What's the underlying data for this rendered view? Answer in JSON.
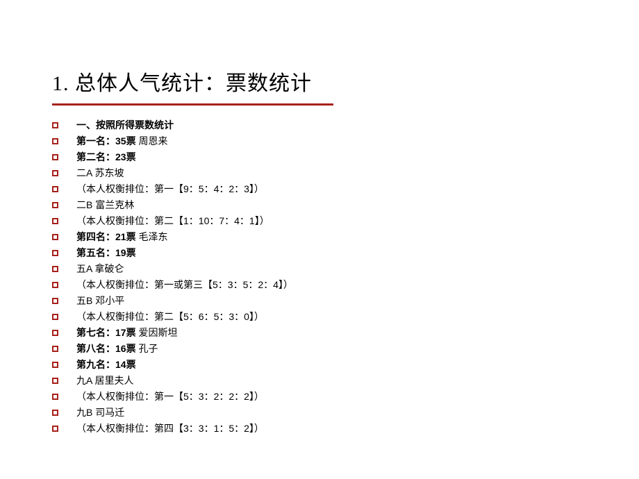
{
  "title": "1.  总体人气统计：票数统计",
  "items": [
    {
      "bold": "一、按照所得票数统计",
      "normal": ""
    },
    {
      "bold": "第一名：35票 ",
      "normal": "周恩来"
    },
    {
      "bold": "第二名：23票",
      "normal": ""
    },
    {
      "bold": "",
      "normal": "二A  苏东坡"
    },
    {
      "bold": "",
      "normal": "（本人权衡排位：第一【9：5：4：2：3】）"
    },
    {
      "bold": "",
      "normal": "二B  富兰克林"
    },
    {
      "bold": "",
      "normal": "（本人权衡排位：第二【1：10：7：4：1】）"
    },
    {
      "bold": "第四名：21票 ",
      "normal": "毛泽东"
    },
    {
      "bold": "第五名：19票",
      "normal": ""
    },
    {
      "bold": "",
      "normal": "五A  拿破仑"
    },
    {
      "bold": "",
      "normal": "（本人权衡排位：第一或第三【5：3：5：2：4】）"
    },
    {
      "bold": "",
      "normal": "五B  邓小平"
    },
    {
      "bold": "",
      "normal": "（本人权衡排位：第二【5：6：5：3：0】）"
    },
    {
      "bold": "第七名：17票 ",
      "normal": "爱因斯坦"
    },
    {
      "bold": "第八名：16票 ",
      "normal": "孔子"
    },
    {
      "bold": "第九名：14票",
      "normal": ""
    },
    {
      "bold": "",
      "normal": "九A  居里夫人"
    },
    {
      "bold": "",
      "normal": "（本人权衡排位：第一【5：3：2：2：2】）"
    },
    {
      "bold": "",
      "normal": "九B  司马迁"
    },
    {
      "bold": "",
      "normal": "（本人权衡排位：第四【3：3：1：5：2】）"
    }
  ]
}
